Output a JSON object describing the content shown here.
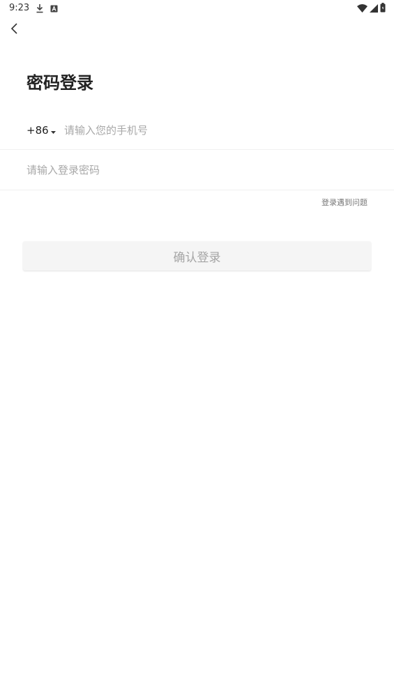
{
  "status_bar": {
    "time": "9:23",
    "left_icons": [
      "download-icon",
      "a-badge-icon"
    ],
    "right_icons": [
      "wifi-icon",
      "signal-icon",
      "battery-icon"
    ]
  },
  "header": {
    "back_icon": "chevron-left-icon",
    "title": "密码登录"
  },
  "form": {
    "country_code": "+86",
    "phone_placeholder": "请输入您的手机号",
    "phone_value": "",
    "password_placeholder": "请输入登录密码",
    "password_value": "",
    "help_link": "登录遇到问题",
    "submit_label": "确认登录"
  },
  "colors": {
    "title": "#222222",
    "placeholder": "#a8a8a8",
    "divider": "#f0f0f0",
    "button_bg": "#f5f5f5",
    "button_text": "#a5a5a5"
  }
}
